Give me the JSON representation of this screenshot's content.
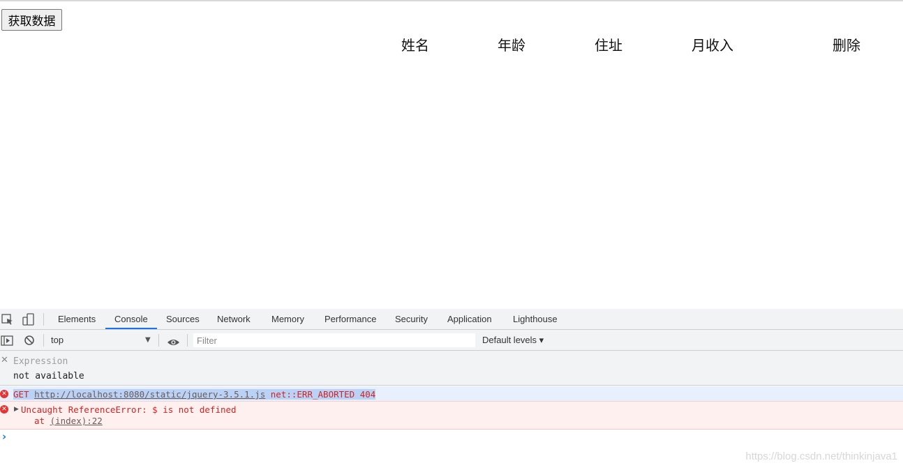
{
  "page": {
    "button_label": "获取数据",
    "table_headers": [
      "姓名",
      "年龄",
      "住址",
      "月收入",
      "删除"
    ]
  },
  "devtools": {
    "tabs": [
      "Elements",
      "Console",
      "Sources",
      "Network",
      "Memory",
      "Performance",
      "Security",
      "Application",
      "Lighthouse"
    ],
    "active_tab": "Console",
    "context": "top",
    "filter_placeholder": "Filter",
    "levels_label": "Default levels ▾",
    "expression_label": "Expression",
    "expression_value": "not available",
    "messages": {
      "m1_method": "GET",
      "m1_url": "http://localhost:8080/static/jquery-3.5.1.js",
      "m1_error": "net::ERR_ABORTED 404",
      "m2_text": "Uncaught ReferenceError: $ is not defined",
      "m2_at": "at ",
      "m2_loc": "(index):22"
    },
    "prompt": "›",
    "watermark": "https://blog.csdn.net/thinkinjava1"
  },
  "colors": {
    "accent": "#1a73e8",
    "error": "#d32222",
    "error_bg": "#fff0f0",
    "selection_bg": "#e8f0fe"
  }
}
